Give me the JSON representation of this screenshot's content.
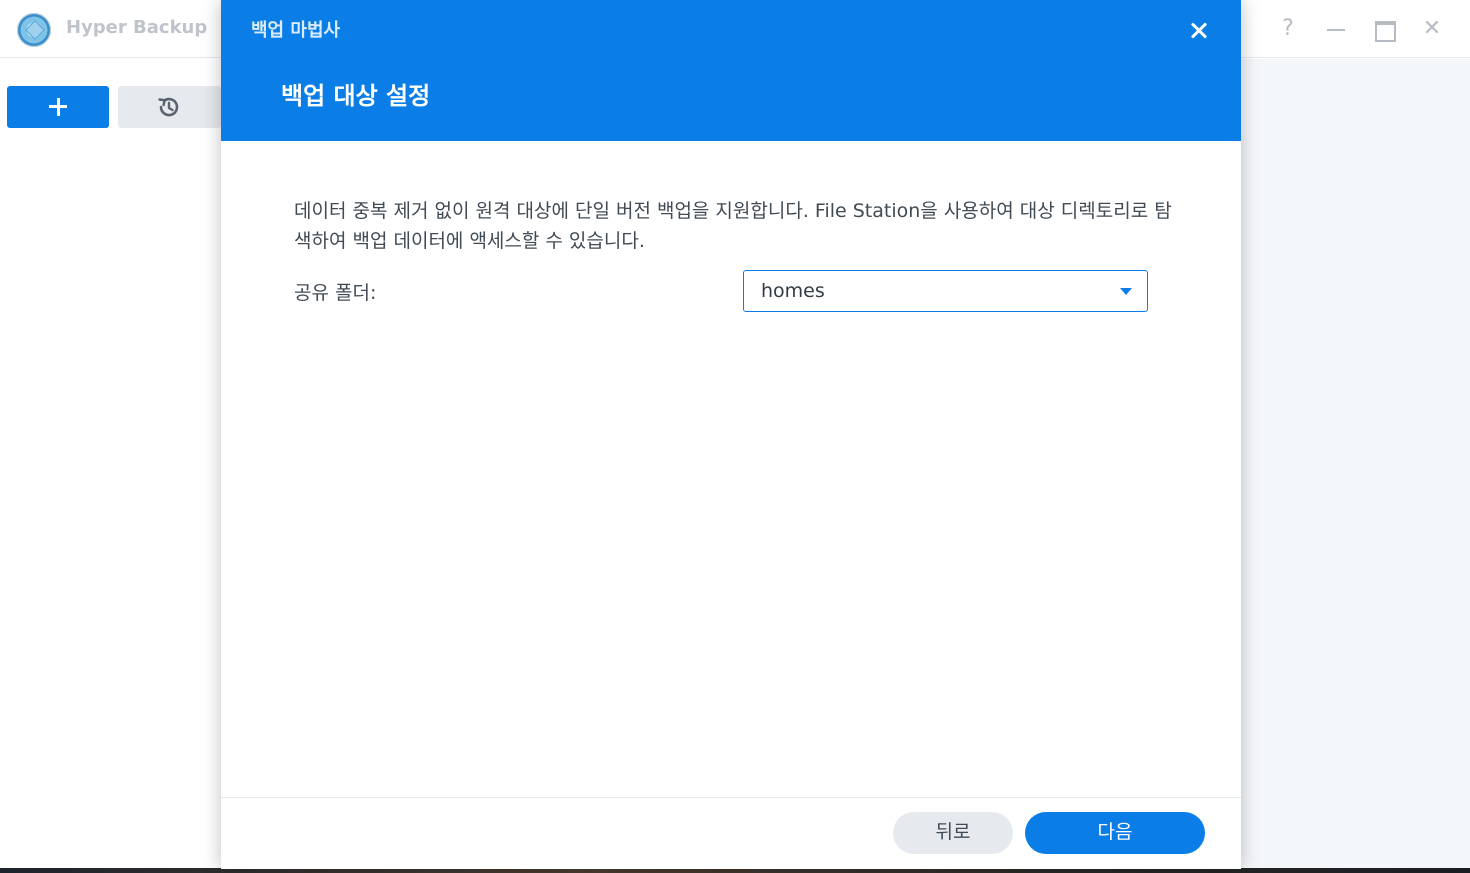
{
  "app": {
    "title": "Hyper Backup",
    "logo_icon": "hyper-backup-logo-icon",
    "controls": {
      "help": "?",
      "close": "✕"
    }
  },
  "toolbar": {
    "add_icon": "plus-icon",
    "restore_icon": "history-icon"
  },
  "wizard": {
    "title": "백업 마법사",
    "step_title": "백업 대상 설정",
    "description": "데이터 중복 제거 없이 원격 대상에 단일 버전 백업을 지원합니다. File Station을 사용하여 대상 디렉토리로 탐색하여 백업 데이터에 액세스할 수 있습니다.",
    "shared_folder": {
      "label": "공유 폴더:",
      "value": "homes"
    },
    "buttons": {
      "back": "뒤로",
      "next": "다음"
    }
  },
  "colors": {
    "accent": "#0a7ee6",
    "header_bg": "#0a7ee6",
    "secondary_button_bg": "#e6eaef",
    "text": "#414b55"
  }
}
